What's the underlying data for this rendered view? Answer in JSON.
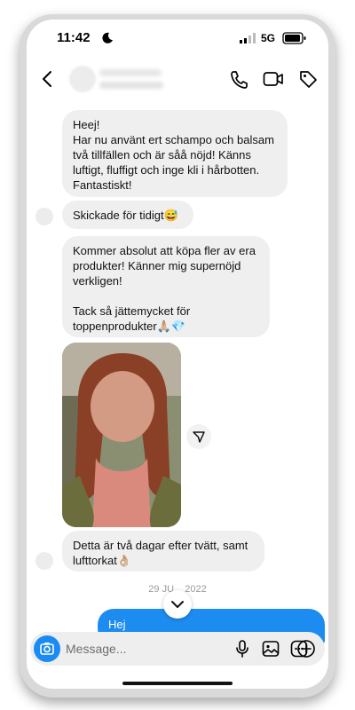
{
  "status_bar": {
    "time": "11:42",
    "network": "5G"
  },
  "messages": [
    {
      "text": "Heej!\nHar nu använt ert schampo och balsam två tillfällen och är såå nöjd! Känns luftigt, fluffigt och inge kli i hårbotten. Fantastiskt!"
    },
    {
      "text": "Skickade för tidigt😅"
    },
    {
      "text": "Kommer absolut att köpa fler av era produkter! Känner mig supernöjd verkligen!\n\nTack så jättemycket för toppenprodukter🙏🏼💎"
    },
    {
      "text": "Detta är två dagar efter tvätt, samt lufttorkat👌🏼"
    }
  ],
  "date_separator": "29 JU... 2022",
  "outgoing_message": "Hej",
  "composer": {
    "placeholder": "Message..."
  },
  "colors": {
    "accent": "#1d8cf0",
    "incoming_bubble": "#efefef"
  },
  "icons": [
    "moon-icon",
    "signal-icon",
    "battery-icon",
    "back-icon",
    "call-icon",
    "video-icon",
    "tag-icon",
    "share-icon",
    "chevron-down-icon",
    "camera-icon",
    "microphone-icon",
    "gallery-icon",
    "sticker-icon",
    "plus-icon"
  ]
}
